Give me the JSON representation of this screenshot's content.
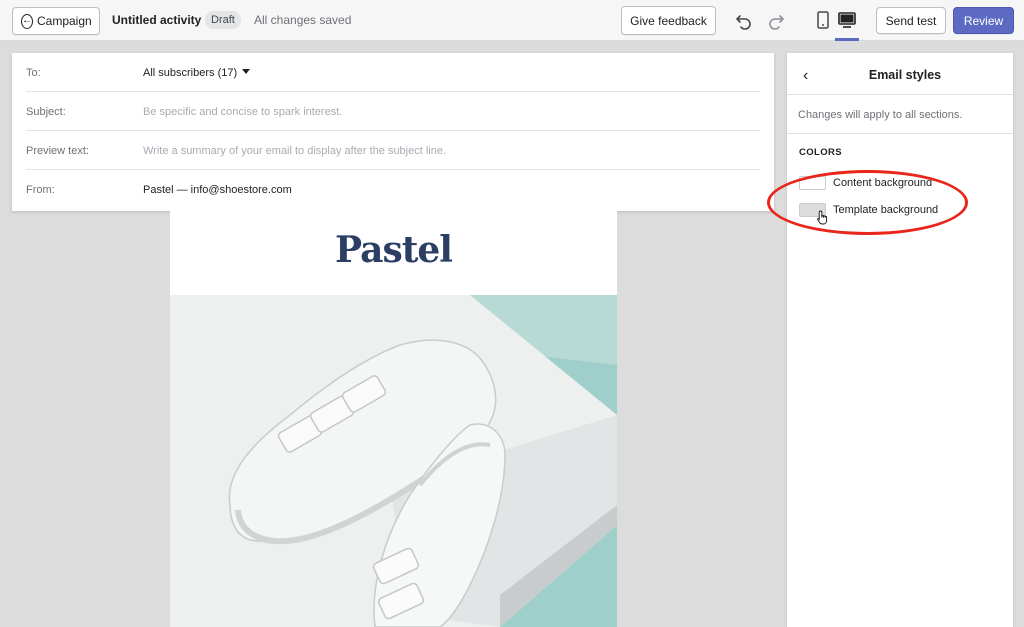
{
  "topbar": {
    "back_label": "Campaign",
    "activity_title": "Untitled activity",
    "status_badge": "Draft",
    "save_status": "All changes saved",
    "feedback_label": "Give feedback",
    "send_test_label": "Send test",
    "review_label": "Review",
    "icons": [
      "back-arrow-icon",
      "undo-icon",
      "redo-icon",
      "mobile-preview-icon",
      "desktop-preview-icon"
    ],
    "accent_color": "#5c6ac4"
  },
  "email_header": {
    "to_label": "To:",
    "to_value": "All subscribers (17)",
    "subject_label": "Subject:",
    "subject_placeholder": "Be specific and concise to spark interest.",
    "preview_label": "Preview text:",
    "preview_placeholder": "Write a summary of your email to display after the subject line.",
    "from_label": "From:",
    "from_value": "Pastel — info@shoestore.com"
  },
  "email_preview": {
    "logo_text": "Pastel"
  },
  "side_panel": {
    "title": "Email styles",
    "note": "Changes will apply to all sections.",
    "colors_heading": "COLORS",
    "content_bg_label": "Content background",
    "content_bg_color": "#ffffff",
    "template_bg_label": "Template background",
    "template_bg_color": "#dcdcdc",
    "annotation_color": "#e8261b"
  }
}
